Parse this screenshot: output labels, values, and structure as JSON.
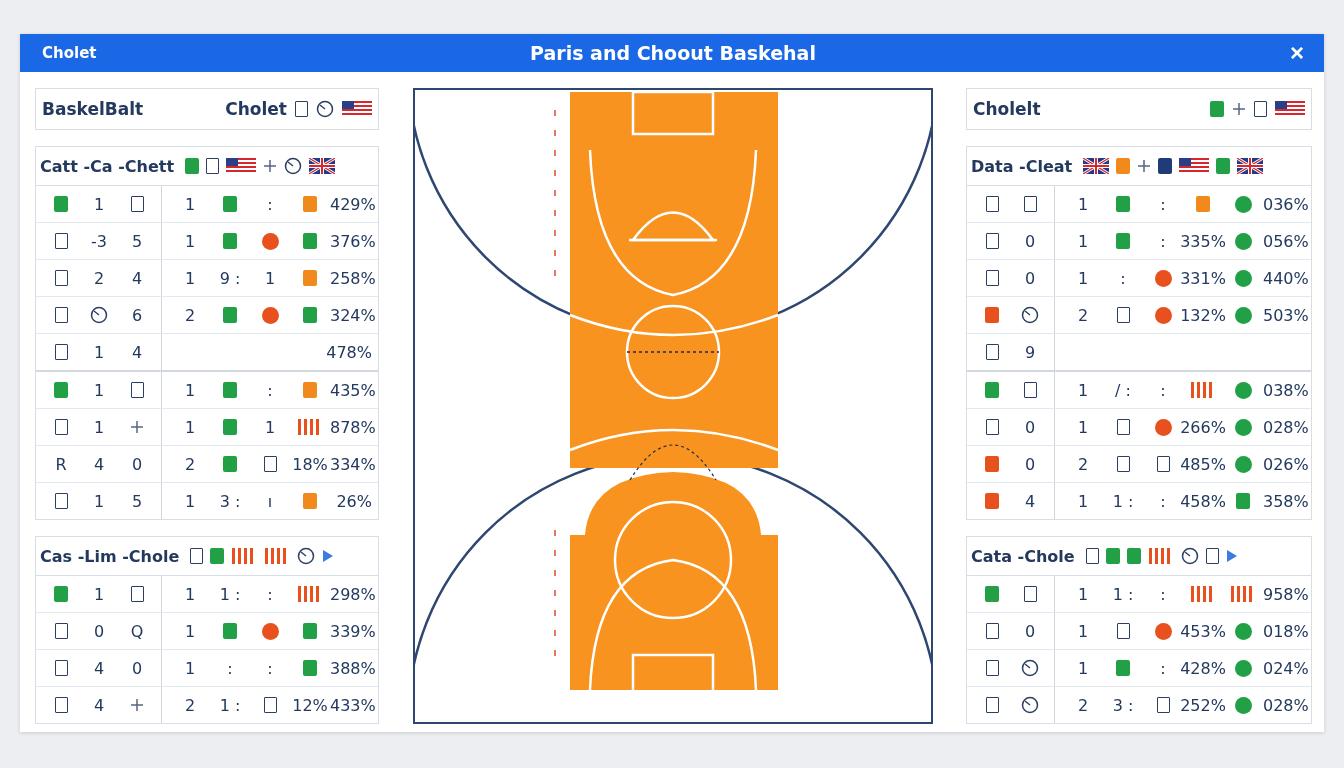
{
  "window": {
    "left_label": "Cholet",
    "title": "Paris and Choout Baskehal",
    "close": "×"
  },
  "left": {
    "card": {
      "title": "BaskelBalt",
      "team": "Cholet",
      "icons": [
        {
          "kind": "box"
        },
        {
          "kind": "dial"
        },
        {
          "kind": "flag_us"
        }
      ]
    },
    "tables": [
      {
        "title": "Catt -Ca -Chett",
        "icons": [
          {
            "kind": "square",
            "color": "#22a045"
          },
          {
            "kind": "box"
          },
          {
            "kind": "flag_us"
          },
          {
            "kind": "plus"
          },
          {
            "kind": "dial"
          },
          {
            "kind": "flag_uk"
          }
        ],
        "groups": [
          [
            {
              "lead": [
                {
                  "kind": "square",
                  "color": "#22a045"
                },
                {
                  "kind": "text",
                  "text": "1"
                },
                {
                  "kind": "box"
                }
              ],
              "body": [
                {
                  "kind": "text",
                  "text": "1"
                },
                {
                  "kind": "square",
                  "color": "#22a045"
                },
                {
                  "kind": "text",
                  "text": ":"
                },
                {
                  "kind": "square",
                  "color": "#f08a1c"
                },
                {
                  "kind": "text",
                  "text": "429%"
                }
              ]
            },
            {
              "lead": [
                {
                  "kind": "box"
                },
                {
                  "kind": "text",
                  "text": "-3"
                },
                {
                  "kind": "text",
                  "text": "5"
                }
              ],
              "body": [
                {
                  "kind": "text",
                  "text": "1"
                },
                {
                  "kind": "square",
                  "color": "#22a045"
                },
                {
                  "kind": "circle",
                  "color": "#e8501e"
                },
                {
                  "kind": "square",
                  "color": "#22a045"
                },
                {
                  "kind": "text",
                  "text": "376%"
                }
              ]
            },
            {
              "lead": [
                {
                  "kind": "box"
                },
                {
                  "kind": "text",
                  "text": "2"
                },
                {
                  "kind": "text",
                  "text": "4"
                }
              ],
              "body": [
                {
                  "kind": "text",
                  "text": "1"
                },
                {
                  "kind": "text",
                  "text": "9 :"
                },
                {
                  "kind": "text",
                  "text": "1"
                },
                {
                  "kind": "square",
                  "color": "#f08a1c"
                },
                {
                  "kind": "text",
                  "text": "258%"
                }
              ]
            },
            {
              "lead": [
                {
                  "kind": "box"
                },
                {
                  "kind": "dial"
                },
                {
                  "kind": "text",
                  "text": "6"
                }
              ],
              "body": [
                {
                  "kind": "text",
                  "text": "2"
                },
                {
                  "kind": "square",
                  "color": "#22a045"
                },
                {
                  "kind": "circle",
                  "color": "#e8501e"
                },
                {
                  "kind": "square",
                  "color": "#22a045"
                },
                {
                  "kind": "text",
                  "text": "324%"
                }
              ]
            },
            {
              "lead": [
                {
                  "kind": "box"
                },
                {
                  "kind": "text",
                  "text": "1"
                },
                {
                  "kind": "text",
                  "text": "4"
                }
              ],
              "body": [
                {
                  "kind": "text",
                  "text": "478%"
                }
              ]
            }
          ],
          [
            {
              "lead": [
                {
                  "kind": "square",
                  "color": "#22a045"
                },
                {
                  "kind": "text",
                  "text": "1"
                },
                {
                  "kind": "box"
                }
              ],
              "body": [
                {
                  "kind": "text",
                  "text": "1"
                },
                {
                  "kind": "square",
                  "color": "#22a045"
                },
                {
                  "kind": "text",
                  "text": ":"
                },
                {
                  "kind": "square",
                  "color": "#f08a1c"
                },
                {
                  "kind": "text",
                  "text": "435%"
                }
              ]
            },
            {
              "lead": [
                {
                  "kind": "box"
                },
                {
                  "kind": "text",
                  "text": "1"
                },
                {
                  "kind": "plus"
                }
              ],
              "body": [
                {
                  "kind": "text",
                  "text": "1"
                },
                {
                  "kind": "square",
                  "color": "#22a045"
                },
                {
                  "kind": "text",
                  "text": "1"
                },
                {
                  "kind": "bars",
                  "color": "#e8501e"
                },
                {
                  "kind": "text",
                  "text": "878%"
                }
              ]
            },
            {
              "lead": [
                {
                  "kind": "text",
                  "text": "R"
                },
                {
                  "kind": "text",
                  "text": "4"
                },
                {
                  "kind": "text",
                  "text": "0"
                }
              ],
              "body": [
                {
                  "kind": "text",
                  "text": "2"
                },
                {
                  "kind": "square",
                  "color": "#22a045"
                },
                {
                  "kind": "box"
                },
                {
                  "kind": "text",
                  "text": "18%"
                },
                {
                  "kind": "text",
                  "text": "334%"
                }
              ]
            },
            {
              "lead": [
                {
                  "kind": "box"
                },
                {
                  "kind": "text",
                  "text": "1"
                },
                {
                  "kind": "text",
                  "text": "5"
                }
              ],
              "body": [
                {
                  "kind": "text",
                  "text": "1"
                },
                {
                  "kind": "text",
                  "text": "3 :"
                },
                {
                  "kind": "text",
                  "text": "ı"
                },
                {
                  "kind": "square",
                  "color": "#f08a1c"
                },
                {
                  "kind": "text",
                  "text": "26%"
                }
              ]
            }
          ]
        ]
      },
      {
        "title": "Cas -Lim -Chole",
        "icons": [
          {
            "kind": "box"
          },
          {
            "kind": "square",
            "color": "#22a045"
          },
          {
            "kind": "bars",
            "color": "#e8501e"
          },
          {
            "kind": "bars",
            "color": "#e8501e"
          },
          {
            "kind": "dial"
          },
          {
            "kind": "play"
          }
        ],
        "groups": [
          [
            {
              "lead": [
                {
                  "kind": "square",
                  "color": "#22a045"
                },
                {
                  "kind": "text",
                  "text": "1"
                },
                {
                  "kind": "box"
                }
              ],
              "body": [
                {
                  "kind": "text",
                  "text": "1"
                },
                {
                  "kind": "text",
                  "text": "1 :"
                },
                {
                  "kind": "text",
                  "text": ":"
                },
                {
                  "kind": "bars",
                  "color": "#e8501e"
                },
                {
                  "kind": "text",
                  "text": "298%"
                }
              ]
            },
            {
              "lead": [
                {
                  "kind": "box"
                },
                {
                  "kind": "text",
                  "text": "0"
                },
                {
                  "kind": "text",
                  "text": "Q"
                }
              ],
              "body": [
                {
                  "kind": "text",
                  "text": "1"
                },
                {
                  "kind": "square",
                  "color": "#22a045"
                },
                {
                  "kind": "circle",
                  "color": "#e8501e"
                },
                {
                  "kind": "square",
                  "color": "#22a045"
                },
                {
                  "kind": "text",
                  "text": "339%"
                }
              ]
            },
            {
              "lead": [
                {
                  "kind": "box"
                },
                {
                  "kind": "text",
                  "text": "4"
                },
                {
                  "kind": "text",
                  "text": "0"
                }
              ],
              "body": [
                {
                  "kind": "text",
                  "text": "1"
                },
                {
                  "kind": "text",
                  "text": ":"
                },
                {
                  "kind": "text",
                  "text": ":"
                },
                {
                  "kind": "square",
                  "color": "#22a045"
                },
                {
                  "kind": "text",
                  "text": "388%"
                }
              ]
            },
            {
              "lead": [
                {
                  "kind": "box"
                },
                {
                  "kind": "text",
                  "text": "4"
                },
                {
                  "kind": "plus"
                }
              ],
              "body": [
                {
                  "kind": "text",
                  "text": "2"
                },
                {
                  "kind": "text",
                  "text": "1 :"
                },
                {
                  "kind": "box"
                },
                {
                  "kind": "text",
                  "text": "12%"
                },
                {
                  "kind": "text",
                  "text": "433%"
                }
              ]
            }
          ]
        ]
      }
    ]
  },
  "right": {
    "card": {
      "title": "Cholelt",
      "icons": [
        {
          "kind": "square",
          "color": "#22a045"
        },
        {
          "kind": "plus"
        },
        {
          "kind": "box"
        },
        {
          "kind": "flag_us"
        }
      ]
    },
    "tables": [
      {
        "title": "Data -Cleat",
        "icons": [
          {
            "kind": "flag_uk"
          },
          {
            "kind": "square",
            "color": "#f08a1c"
          },
          {
            "kind": "plus"
          },
          {
            "kind": "square",
            "color": "#1f3b78"
          },
          {
            "kind": "flag_us"
          },
          {
            "kind": "square",
            "color": "#22a045"
          },
          {
            "kind": "flag_uk"
          }
        ],
        "groups": [
          [
            {
              "lead": [
                {
                  "kind": "box"
                },
                {
                  "kind": "box"
                }
              ],
              "body": [
                {
                  "kind": "text",
                  "text": "1"
                },
                {
                  "kind": "square",
                  "color": "#22a045"
                },
                {
                  "kind": "text",
                  "text": ":"
                },
                {
                  "kind": "square",
                  "color": "#f08a1c"
                },
                {
                  "kind": "circle",
                  "color": "#22a045"
                },
                {
                  "kind": "text",
                  "text": "036%"
                }
              ]
            },
            {
              "lead": [
                {
                  "kind": "box"
                },
                {
                  "kind": "text",
                  "text": "0"
                }
              ],
              "body": [
                {
                  "kind": "text",
                  "text": "1"
                },
                {
                  "kind": "square",
                  "color": "#22a045"
                },
                {
                  "kind": "text",
                  "text": ":"
                },
                {
                  "kind": "text",
                  "text": "335%"
                },
                {
                  "kind": "circle",
                  "color": "#22a045"
                },
                {
                  "kind": "text",
                  "text": "056%"
                }
              ]
            },
            {
              "lead": [
                {
                  "kind": "box"
                },
                {
                  "kind": "text",
                  "text": "0"
                }
              ],
              "body": [
                {
                  "kind": "text",
                  "text": "1"
                },
                {
                  "kind": "text",
                  "text": ":"
                },
                {
                  "kind": "circle",
                  "color": "#e8501e"
                },
                {
                  "kind": "text",
                  "text": "331%"
                },
                {
                  "kind": "circle",
                  "color": "#22a045"
                },
                {
                  "kind": "text",
                  "text": "440%"
                }
              ]
            },
            {
              "lead": [
                {
                  "kind": "square",
                  "color": "#e8501e"
                },
                {
                  "kind": "dial"
                }
              ],
              "body": [
                {
                  "kind": "text",
                  "text": "2"
                },
                {
                  "kind": "box"
                },
                {
                  "kind": "circle",
                  "color": "#e8501e"
                },
                {
                  "kind": "text",
                  "text": "132%"
                },
                {
                  "kind": "circle",
                  "color": "#22a045"
                },
                {
                  "kind": "text",
                  "text": "503%"
                }
              ]
            },
            {
              "lead": [
                {
                  "kind": "box"
                },
                {
                  "kind": "text",
                  "text": "9"
                }
              ]
            }
          ],
          [
            {
              "lead": [
                {
                  "kind": "square",
                  "color": "#22a045"
                },
                {
                  "kind": "box"
                }
              ],
              "body": [
                {
                  "kind": "text",
                  "text": "1"
                },
                {
                  "kind": "text",
                  "text": "/ :"
                },
                {
                  "kind": "text",
                  "text": ":"
                },
                {
                  "kind": "bars",
                  "color": "#e8501e"
                },
                {
                  "kind": "circle",
                  "color": "#22a045"
                },
                {
                  "kind": "text",
                  "text": "038%"
                }
              ]
            },
            {
              "lead": [
                {
                  "kind": "box"
                },
                {
                  "kind": "text",
                  "text": "0"
                }
              ],
              "body": [
                {
                  "kind": "text",
                  "text": "1"
                },
                {
                  "kind": "box"
                },
                {
                  "kind": "circle",
                  "color": "#e8501e"
                },
                {
                  "kind": "text",
                  "text": "266%"
                },
                {
                  "kind": "circle",
                  "color": "#22a045"
                },
                {
                  "kind": "text",
                  "text": "028%"
                }
              ]
            },
            {
              "lead": [
                {
                  "kind": "square",
                  "color": "#e8501e"
                },
                {
                  "kind": "text",
                  "text": "0"
                }
              ],
              "body": [
                {
                  "kind": "text",
                  "text": "2"
                },
                {
                  "kind": "box"
                },
                {
                  "kind": "box"
                },
                {
                  "kind": "text",
                  "text": "485%"
                },
                {
                  "kind": "circle",
                  "color": "#22a045"
                },
                {
                  "kind": "text",
                  "text": "026%"
                }
              ]
            },
            {
              "lead": [
                {
                  "kind": "square",
                  "color": "#e8501e"
                },
                {
                  "kind": "text",
                  "text": "4"
                }
              ],
              "body": [
                {
                  "kind": "text",
                  "text": "1"
                },
                {
                  "kind": "text",
                  "text": "1 :"
                },
                {
                  "kind": "text",
                  "text": ":"
                },
                {
                  "kind": "text",
                  "text": "458%"
                },
                {
                  "kind": "square",
                  "color": "#22a045"
                },
                {
                  "kind": "text",
                  "text": "358%"
                }
              ]
            }
          ]
        ]
      },
      {
        "title": "Cata -Chole",
        "icons": [
          {
            "kind": "box"
          },
          {
            "kind": "square",
            "color": "#22a045"
          },
          {
            "kind": "square",
            "color": "#22a045"
          },
          {
            "kind": "bars",
            "color": "#e8501e"
          },
          {
            "kind": "dial"
          },
          {
            "kind": "box"
          },
          {
            "kind": "play"
          }
        ],
        "groups": [
          [
            {
              "lead": [
                {
                  "kind": "square",
                  "color": "#22a045"
                },
                {
                  "kind": "box"
                }
              ],
              "body": [
                {
                  "kind": "text",
                  "text": "1"
                },
                {
                  "kind": "text",
                  "text": "1 :"
                },
                {
                  "kind": "text",
                  "text": ":"
                },
                {
                  "kind": "bars",
                  "color": "#e8501e"
                },
                {
                  "kind": "bars",
                  "color": "#e8501e"
                },
                {
                  "kind": "text",
                  "text": "958%"
                }
              ]
            },
            {
              "lead": [
                {
                  "kind": "box"
                },
                {
                  "kind": "text",
                  "text": "0"
                }
              ],
              "body": [
                {
                  "kind": "text",
                  "text": "1"
                },
                {
                  "kind": "box"
                },
                {
                  "kind": "circle",
                  "color": "#e8501e"
                },
                {
                  "kind": "text",
                  "text": "453%"
                },
                {
                  "kind": "circle",
                  "color": "#22a045"
                },
                {
                  "kind": "text",
                  "text": "018%"
                }
              ]
            },
            {
              "lead": [
                {
                  "kind": "box"
                },
                {
                  "kind": "dial"
                }
              ],
              "body": [
                {
                  "kind": "text",
                  "text": "1"
                },
                {
                  "kind": "square",
                  "color": "#22a045"
                },
                {
                  "kind": "text",
                  "text": ":"
                },
                {
                  "kind": "text",
                  "text": "428%"
                },
                {
                  "kind": "circle",
                  "color": "#22a045"
                },
                {
                  "kind": "text",
                  "text": "024%"
                }
              ]
            },
            {
              "lead": [
                {
                  "kind": "box"
                },
                {
                  "kind": "dial"
                }
              ],
              "body": [
                {
                  "kind": "text",
                  "text": "2"
                },
                {
                  "kind": "text",
                  "text": "3 :"
                },
                {
                  "kind": "box"
                },
                {
                  "kind": "text",
                  "text": "252%"
                },
                {
                  "kind": "circle",
                  "color": "#22a045"
                },
                {
                  "kind": "text",
                  "text": "028%"
                }
              ]
            }
          ]
        ]
      }
    ]
  }
}
